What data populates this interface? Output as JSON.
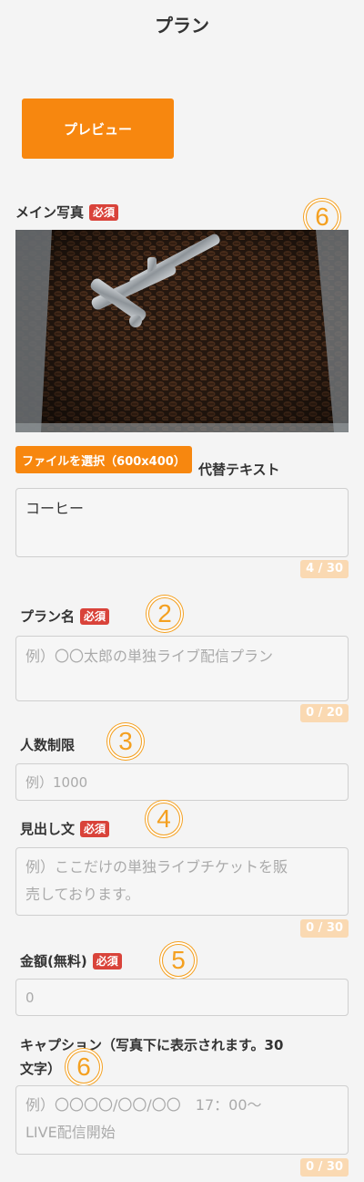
{
  "page": {
    "title": "プラン"
  },
  "preview_button": "プレビュー",
  "main_photo": {
    "label": "メイン写真",
    "required": "必須",
    "marker": "6"
  },
  "file_button": "ファイルを選択（600x400）",
  "alt_text": {
    "label": "代替テキスト",
    "value": "コーヒー",
    "counter": "4 / 30"
  },
  "plan_name": {
    "label": "プラン名",
    "required": "必須",
    "marker": "2",
    "placeholder": "例）〇〇太郎の単独ライブ配信プラン",
    "counter": "0 / 20"
  },
  "capacity": {
    "label": "人数制限",
    "marker": "3",
    "placeholder": "例）1000"
  },
  "headline": {
    "label": "見出し文",
    "required": "必須",
    "marker": "4",
    "placeholder_line1": "例）ここだけの単独ライブチケットを販",
    "placeholder_line2": "売しております。",
    "counter": "0 / 30"
  },
  "price": {
    "label": "金額(無料)",
    "required": "必須",
    "marker": "5",
    "placeholder": "0"
  },
  "caption": {
    "label_line1": "キャプション（写真下に表示されます。30",
    "label_line2": "文字）",
    "marker": "6",
    "placeholder_line1": "例）〇〇〇〇/〇〇/〇〇　17：00〜",
    "placeholder_line2": "LIVE配信開始",
    "counter": "0 / 30"
  },
  "colors": {
    "accent": "#f7870f",
    "required_badge": "#d9433a",
    "marker": "#f4a020",
    "counter_bg": "#fad9b2"
  }
}
